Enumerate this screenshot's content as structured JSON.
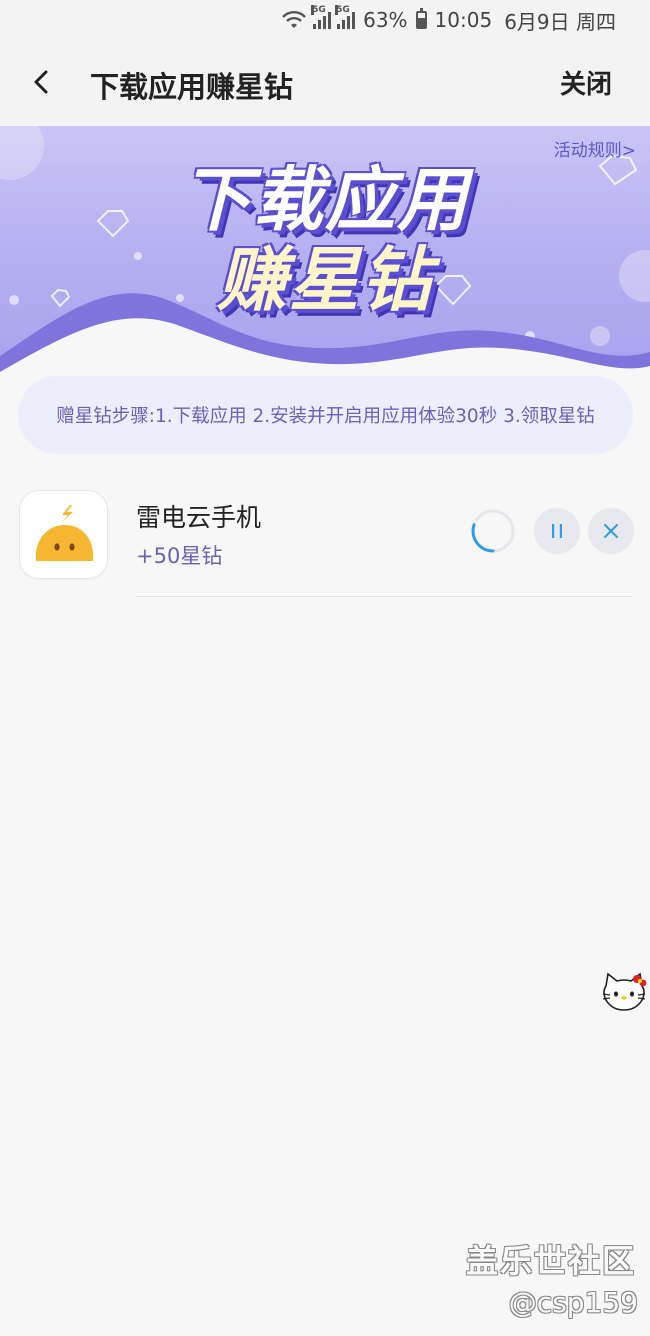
{
  "status_bar": {
    "network_tag_1": "5G",
    "network_tag_2": "5G",
    "battery": "63%",
    "time": "10:05",
    "date": "6月9日 周四"
  },
  "header": {
    "title": "下载应用赚星钻",
    "close_label": "关闭"
  },
  "banner": {
    "rules_link": "活动规则>",
    "title_line1": "下载应用",
    "title_line2": "赚星钻"
  },
  "steps_text": "赠星钻步骤:1.下载应用 2.安装并开启用应用体验30秒 3.领取星钻",
  "apps": [
    {
      "name": "雷电云手机",
      "reward": "+50星钻",
      "download_progress": 0.3,
      "icon": "yellow-blob-lightning-icon"
    }
  ],
  "colors": {
    "accent": "#6a63b5",
    "progress": "#2f9ee8",
    "banner": "#b7b2f1",
    "app_icon": "#f5b731"
  },
  "watermark": {
    "site": "盖乐世社区",
    "user": "@csp159"
  }
}
